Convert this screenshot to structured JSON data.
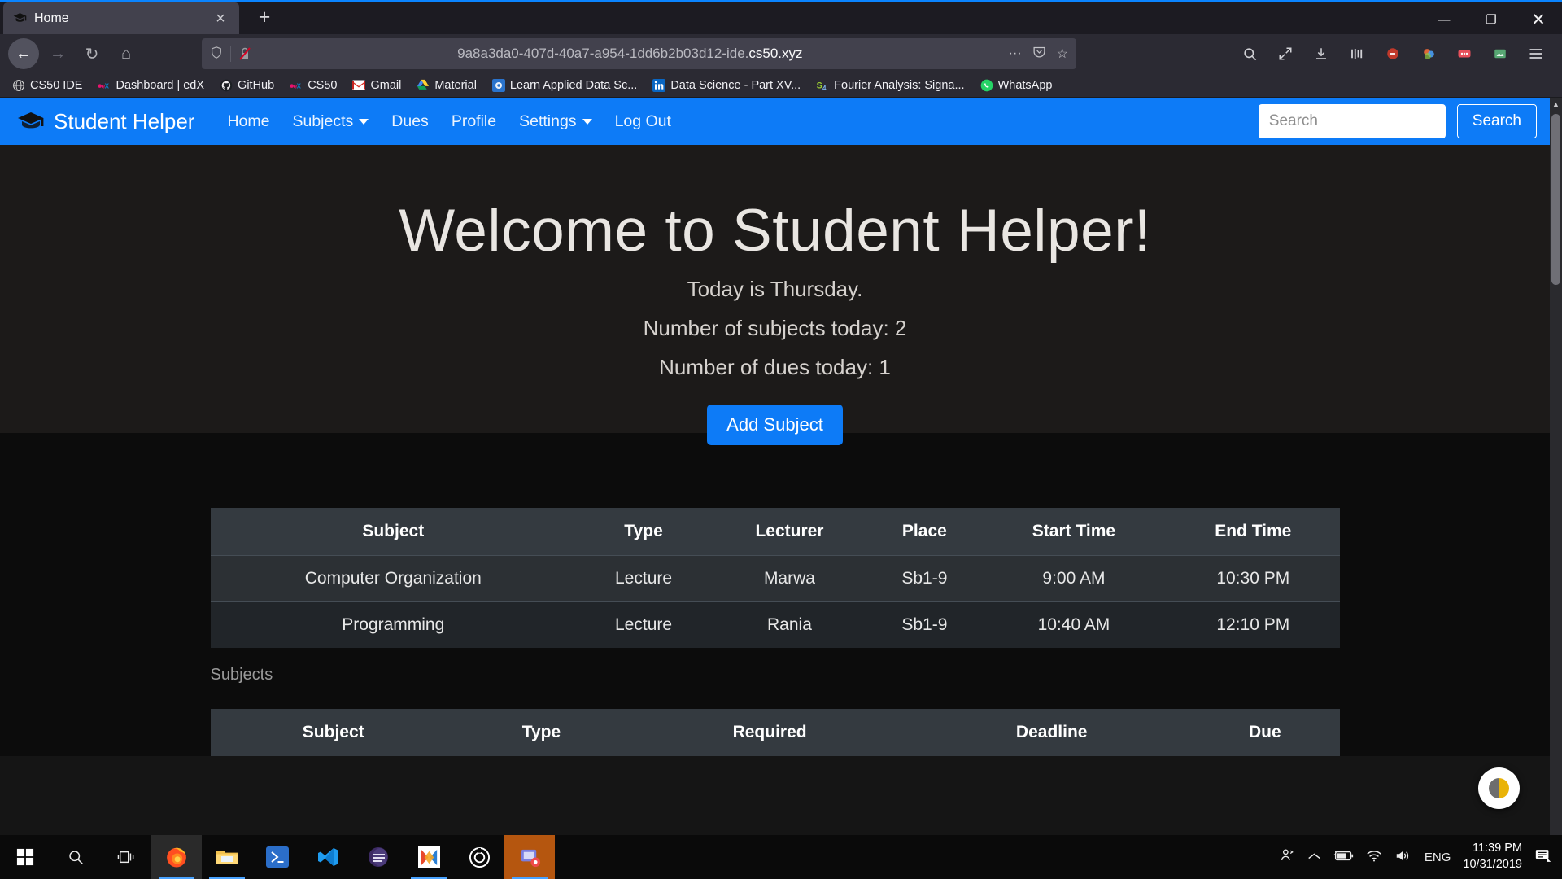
{
  "browser": {
    "tab": {
      "title": "Home",
      "favicon": "graduation-cap-icon",
      "close": "×"
    },
    "new_tab": "+",
    "window_controls": {
      "minimize": "—",
      "maximize": "❐",
      "close": "✕"
    },
    "nav": {
      "back": "←",
      "forward": "→",
      "reload": "↻",
      "home": "⌂"
    },
    "url": {
      "prefix": "9a8a3da0-407d-40a7-a954-1dd6b2b03d12-ide.",
      "domain": "cs50.xyz",
      "full": "9a8a3da0-407d-40a7-a954-1dd6b2b03d12-ide.cs50.xyz"
    },
    "url_actions": {
      "more": "···",
      "pocket": "ⓥ",
      "bookmark": "☆"
    },
    "toolbar_icons": [
      "search-icon",
      "fullscreen-icon",
      "downloads-icon",
      "library-icon",
      "shield-icon",
      "container-icon",
      "extension-icon",
      "sync-icon",
      "menu-icon"
    ],
    "bookmarks": [
      {
        "label": "CS50 IDE",
        "icon": "globe-icon",
        "color": "#cfcfcf"
      },
      {
        "label": "Dashboard | edX",
        "icon": "edx-icon",
        "color": "#e8126d"
      },
      {
        "label": "GitHub",
        "icon": "github-icon",
        "color": "#1b1f23"
      },
      {
        "label": "CS50",
        "icon": "edx-icon",
        "color": "#e8126d"
      },
      {
        "label": "Gmail",
        "icon": "gmail-icon",
        "color": "#d93025"
      },
      {
        "label": "Material",
        "icon": "google-drive-icon",
        "color": "#0f9d58"
      },
      {
        "label": "Learn Applied Data Sc...",
        "icon": "coursera-icon",
        "color": "#2a73cc"
      },
      {
        "label": "Data Science - Part XV...",
        "icon": "linkedin-icon",
        "color": "#0a66c2"
      },
      {
        "label": "Fourier Analysis: Signa...",
        "icon": "s4-icon",
        "color": "#8db600"
      },
      {
        "label": "WhatsApp",
        "icon": "whatsapp-icon",
        "color": "#25d366"
      }
    ]
  },
  "app": {
    "brand": "Student Helper",
    "brand_icon": "graduation-cap-icon",
    "nav_links": [
      {
        "label": "Home",
        "dropdown": false
      },
      {
        "label": "Subjects",
        "dropdown": true
      },
      {
        "label": "Dues",
        "dropdown": false
      },
      {
        "label": "Profile",
        "dropdown": false
      },
      {
        "label": "Settings",
        "dropdown": true
      },
      {
        "label": "Log Out",
        "dropdown": false
      }
    ],
    "search": {
      "placeholder": "Search",
      "value": "",
      "button": "Search"
    },
    "accent_color": "#0d7bf7",
    "hero": {
      "title": "Welcome to Student Helper!",
      "line1": "Today is Thursday.",
      "line2": "Number of subjects today: 2",
      "line3": "Number of dues today: 1",
      "cta": "Add Subject"
    },
    "schedule_table": {
      "headers": [
        "Subject",
        "Type",
        "Lecturer",
        "Place",
        "Start Time",
        "End Time"
      ],
      "rows": [
        [
          "Computer Organization",
          "Lecture",
          "Marwa",
          "Sb1-9",
          "9:00 AM",
          "10:30 PM"
        ],
        [
          "Programming",
          "Lecture",
          "Rania",
          "Sb1-9",
          "10:40 AM",
          "12:10 PM"
        ]
      ]
    },
    "subjects_section": {
      "label": "Subjects",
      "headers": [
        "Subject",
        "Type",
        "Required",
        "Deadline",
        "Due"
      ]
    },
    "fab": "theme-toggle-icon"
  },
  "taskbar": {
    "start": "windows-start-icon",
    "items": [
      {
        "name": "search-icon",
        "state": "idle"
      },
      {
        "name": "task-view-icon",
        "state": "idle"
      },
      {
        "name": "firefox-icon",
        "state": "active"
      },
      {
        "name": "file-explorer-icon",
        "state": "running"
      },
      {
        "name": "powershell-icon",
        "state": "idle"
      },
      {
        "name": "vscode-icon",
        "state": "idle"
      },
      {
        "name": "eclipse-icon",
        "state": "idle"
      },
      {
        "name": "office-icon",
        "state": "running"
      },
      {
        "name": "spiral-icon",
        "state": "idle"
      },
      {
        "name": "screenshot-tool-icon",
        "state": "active"
      }
    ],
    "tray": {
      "people": "people-icon",
      "chevron": "show-hidden-icons-icon",
      "battery": "battery-charging-icon",
      "wifi": "wifi-icon",
      "volume": "volume-icon",
      "language": "ENG",
      "time": "11:39 PM",
      "date": "10/31/2019",
      "action_center": "notifications-icon"
    }
  }
}
